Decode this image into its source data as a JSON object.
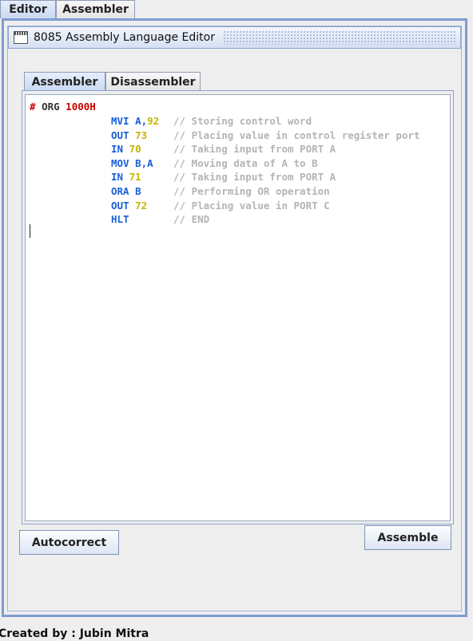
{
  "top_tabs": {
    "editor": "Editor",
    "assembler": "Assembler"
  },
  "window": {
    "title": "8085 Assembly Language Editor"
  },
  "inner_tabs": {
    "assembler": "Assembler",
    "disassembler": "Disassembler"
  },
  "code": {
    "header": {
      "hash": "#",
      "keyword": "ORG",
      "address": "1000H"
    },
    "lines": [
      {
        "op": "MVI A,",
        "arg": "92",
        "comment": "// Storing control word"
      },
      {
        "op": "OUT ",
        "arg": "73",
        "comment": "// Placing value in control register port"
      },
      {
        "op": "IN ",
        "arg": "70",
        "comment": "// Taking input from PORT A"
      },
      {
        "op": "MOV B,A",
        "arg": "",
        "comment": "// Moving data of A to B"
      },
      {
        "op": "IN ",
        "arg": "71",
        "comment": "// Taking input from PORT A"
      },
      {
        "op": "ORA B",
        "arg": "",
        "comment": "// Performing OR operation"
      },
      {
        "op": "OUT ",
        "arg": "72",
        "comment": "// Placing value in PORT C"
      },
      {
        "op": "HLT",
        "arg": "",
        "comment": "// END"
      }
    ]
  },
  "buttons": {
    "autocorrect": "Autocorrect",
    "assemble": "Assemble"
  },
  "footer": {
    "credit": "Created by : Jubin Mitra"
  }
}
